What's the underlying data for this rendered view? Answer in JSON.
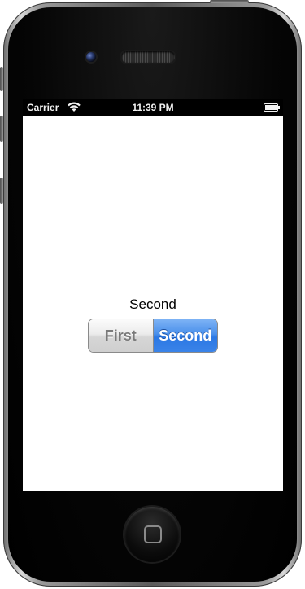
{
  "status_bar": {
    "carrier": "Carrier",
    "time": "11:39 PM",
    "wifi_icon": "wifi-icon",
    "battery_icon": "battery-icon"
  },
  "main": {
    "selected_label": "Second",
    "segmented_control": {
      "segments": [
        {
          "label": "First",
          "selected": false
        },
        {
          "label": "Second",
          "selected": true
        }
      ],
      "accent_color": "#3a83e8"
    }
  },
  "device": {
    "camera_icon": "camera-icon",
    "speaker_icon": "speaker-grille-icon",
    "home_button_icon": "home-square-icon"
  }
}
